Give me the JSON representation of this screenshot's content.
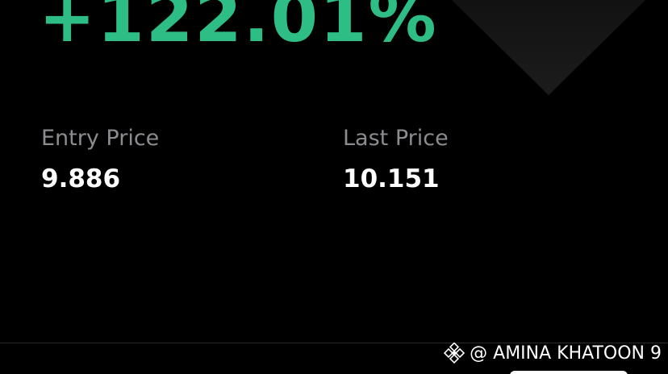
{
  "pnl": {
    "percent": "+122.01%",
    "color": "#2ebd85"
  },
  "entry": {
    "label": "Entry Price",
    "value": "9.886"
  },
  "last": {
    "label": "Last Price",
    "value": "10.151"
  },
  "watermark": {
    "text": "@ AMINA KHATOON 9",
    "icon": "binance-logo-icon"
  }
}
